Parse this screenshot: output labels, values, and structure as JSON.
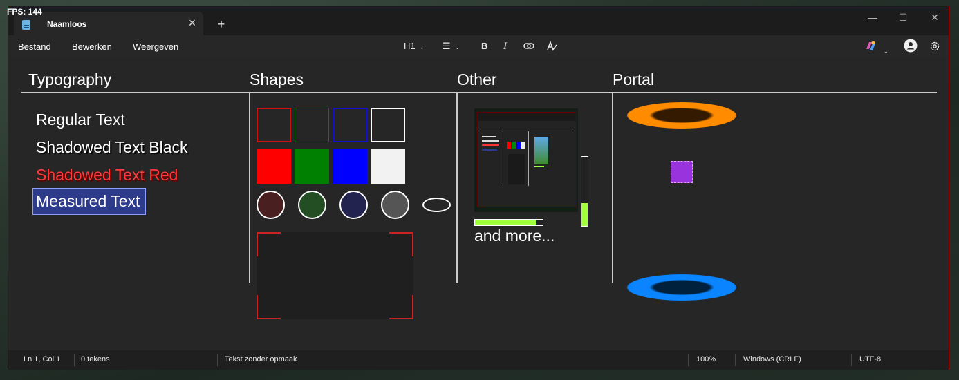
{
  "overlay": {
    "fps": "FPS: 144"
  },
  "tab": {
    "title": "Naamloos",
    "close": "✕",
    "new": "+"
  },
  "window_controls": {
    "minimize": "—",
    "maximize": "☐",
    "close": "✕"
  },
  "menu": {
    "file": "Bestand",
    "edit": "Bewerken",
    "view": "Weergeven"
  },
  "toolbar": {
    "heading": "H1",
    "list_glyph": "☰",
    "bold": "B",
    "italic": "I",
    "link_glyph": "🔗",
    "spell_glyph": "A",
    "chevron": "⌄"
  },
  "columns": {
    "typography": "Typography",
    "shapes": "Shapes",
    "other": "Other",
    "portal": "Portal"
  },
  "typography": {
    "regular": "Regular Text",
    "shadow_black": "Shadowed Text Black",
    "shadow_red": "Shadowed Text Red",
    "measured": "Measured Text"
  },
  "shapes": {
    "outline_colors": [
      "#cc1111",
      "#117711",
      "#1111cc",
      "#ffffff"
    ],
    "fill_colors": [
      "#ff0000",
      "#008000",
      "#0000ff",
      "#f2f2f2"
    ],
    "circle_colors": [
      "#4a1f1f",
      "#234d23",
      "#23234f",
      "#555555"
    ]
  },
  "other": {
    "more_label": "and more...",
    "progress_horizontal": 0.9,
    "progress_vertical": 0.33,
    "accent": "#a3ff3c"
  },
  "portal": {
    "orange": "#ff8c00",
    "blue": "#0a84ff",
    "box_color": "#9933dd"
  },
  "status": {
    "position": "Ln 1, Col 1",
    "chars": "0 tekens",
    "format": "Tekst zonder opmaak",
    "zoom": "100%",
    "line_endings": "Windows (CRLF)",
    "encoding": "UTF-8"
  }
}
